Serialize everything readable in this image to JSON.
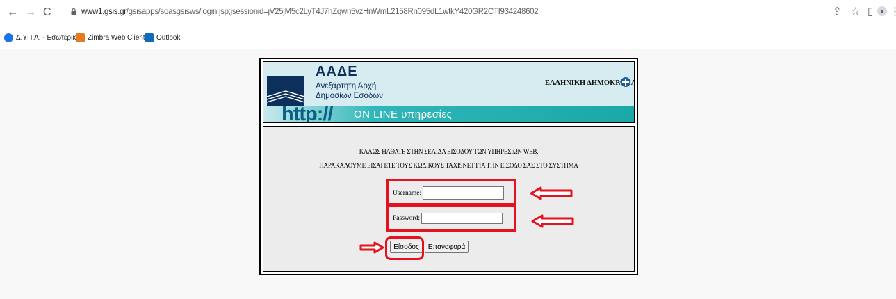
{
  "browser": {
    "url_host": "www1.gsis.gr",
    "url_path": "/gsisapps/soasgsisws/login.jsp;jsessionid=jV25jM5c2LyT4J7hZqwn5vzHnWmL2158Rn095dL1wtkY420GR2CTI934248602",
    "bookmarks": [
      {
        "label": "Δ.ΥΠ.Α. - Εσωτερικ...",
        "icon": "dypa-icon",
        "color": "#1a73e8"
      },
      {
        "label": "Zimbra Web Client...",
        "icon": "zimbra-icon",
        "color": "#e57b1f"
      },
      {
        "label": "Outlook",
        "icon": "outlook-icon",
        "color": "#0f6cbd"
      }
    ]
  },
  "header": {
    "brand_title": "ΑΑΔΕ",
    "brand_sub1": "Ανεξάρτητη Αρχή",
    "brand_sub2": "Δημοσίων Εσόδων",
    "gov_text": "ΕΛΛΗΝΙΚΗ ΔΗΜΟΚΡΑΤΙΑ",
    "ribbon_http": "http://",
    "ribbon_text": "ON LINE υπηρεσίες"
  },
  "login": {
    "welcome": "ΚΑΛΩΣ ΗΛΘΑΤΕ ΣΤΗΝ ΣΕΛΙΔΑ ΕΙΣΟΔΟΥ ΤΩΝ ΥΠΗΡΕΣΙΩΝ WEB.",
    "instructions": "ΠΑΡΑΚΑΛΟΥΜΕ ΕΙΣΑΓΕΤΕ ΤΟΥΣ ΚΩΔΙΚΟΥΣ TAXISNET ΓΙΑ ΤΗΝ ΕΙΣΟΔΟ ΣΑΣ ΣΤΟ ΣΥΣΤΗΜΑ",
    "username_label": "Username:",
    "username_value": "",
    "password_label": "Password:",
    "password_value": "",
    "login_button": "Είσοδος",
    "reset_button": "Επαναφορά"
  },
  "colors": {
    "annotation_red": "#e3121e",
    "brand_navy": "#0c2f5c",
    "ribbon_teal": "#1aa8a8"
  }
}
